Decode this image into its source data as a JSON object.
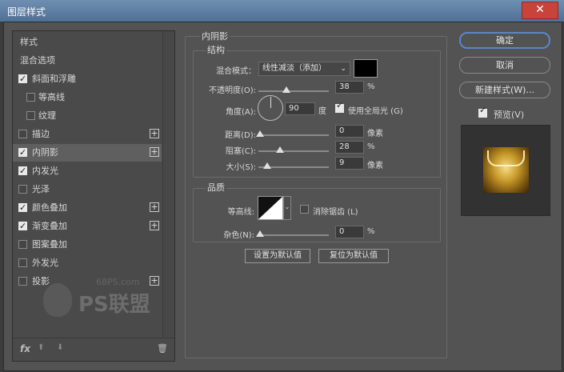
{
  "window": {
    "title": "图层样式",
    "close_glyph": "✕"
  },
  "left_list": {
    "items": [
      {
        "label": "样式",
        "type": "plain"
      },
      {
        "label": "混合选项",
        "type": "plain"
      },
      {
        "label": "斜面和浮雕",
        "type": "check",
        "checked": true
      },
      {
        "label": "等高线",
        "type": "indent",
        "checked": false
      },
      {
        "label": "纹理",
        "type": "indent",
        "checked": false
      },
      {
        "label": "描边",
        "type": "check",
        "checked": false,
        "plus": true
      },
      {
        "label": "内阴影",
        "type": "check",
        "checked": true,
        "plus": true,
        "selected": true
      },
      {
        "label": "内发光",
        "type": "check",
        "checked": true
      },
      {
        "label": "光泽",
        "type": "check",
        "checked": false
      },
      {
        "label": "颜色叠加",
        "type": "check",
        "checked": true,
        "plus": true
      },
      {
        "label": "渐变叠加",
        "type": "check",
        "checked": true,
        "plus": true
      },
      {
        "label": "图案叠加",
        "type": "check",
        "checked": false
      },
      {
        "label": "外发光",
        "type": "check",
        "checked": false
      },
      {
        "label": "投影",
        "type": "check",
        "checked": false,
        "plus": true
      }
    ],
    "plus_glyph": "+",
    "fx_label": "fx",
    "up_glyph": "⬆",
    "down_glyph": "⬇",
    "trash_glyph": "🗑"
  },
  "watermark": {
    "site": "68PS.com",
    "logo_text": "PS联盟"
  },
  "panel": {
    "title": "内阴影",
    "structure": {
      "title": "结构",
      "blend_mode_label": "混合模式：",
      "blend_mode_value": "线性减淡（添加）",
      "blend_color": "#000000",
      "opacity_label": "不透明度(O):",
      "opacity_value": "38",
      "opacity_unit": "%",
      "angle_label": "角度(A):",
      "angle_value": "90",
      "angle_unit": "度",
      "global_light_label": "使用全局光 (G)",
      "global_light_checked": true,
      "distance_label": "距离(D):",
      "distance_value": "0",
      "distance_unit": "像素",
      "choke_label": "阻塞(C):",
      "choke_value": "28",
      "choke_unit": "%",
      "size_label": "大小(S):",
      "size_value": "9",
      "size_unit": "像素"
    },
    "quality": {
      "title": "品质",
      "contour_label": "等高线:",
      "antialias_label": "消除锯齿 (L)",
      "antialias_checked": false,
      "noise_label": "杂色(N):",
      "noise_value": "0",
      "noise_unit": "%"
    },
    "set_default_label": "设置为默认值",
    "reset_default_label": "复位为默认值"
  },
  "right": {
    "ok_label": "确定",
    "cancel_label": "取消",
    "new_style_label": "新建样式(W)...",
    "preview_label": "预览(V)",
    "preview_checked": true
  }
}
